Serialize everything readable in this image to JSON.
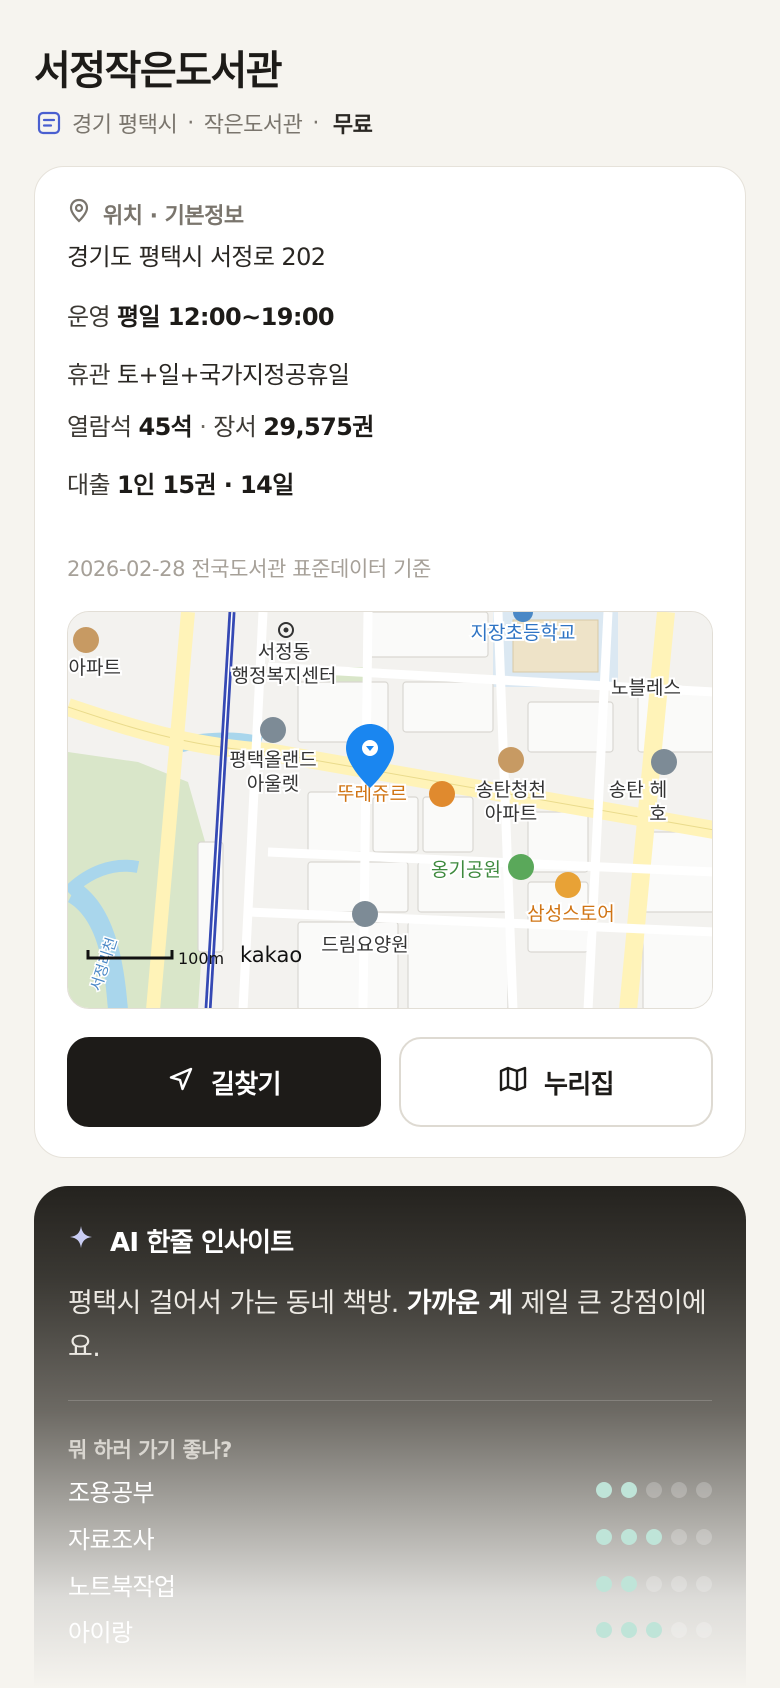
{
  "header": {
    "title": "서정작은도서관",
    "region": "경기 평택시",
    "sep1": "·",
    "type": "작은도서관",
    "sep2": "·",
    "fee": "무료"
  },
  "info": {
    "section_title": "위치 · 기본정보",
    "address": "경기도 평택시 서정로 202",
    "hours_label": "운영",
    "hours_value": "평일 12:00~19:00",
    "closed_label": "휴관",
    "closed_value": "토+일+국가지정공휴일",
    "seats_label": "열람석",
    "seats_value": "45석",
    "books_sep": "·",
    "books_label": "장서",
    "books_value": "29,575권",
    "loan_label": "대출",
    "loan_value": "1인 15권 · 14일",
    "as_of": "2026-02-28 전국도서관 표준데이터 기준"
  },
  "map": {
    "labels": {
      "school": "지장초등학교",
      "apt_left": "장아파트",
      "office_1": "서정동",
      "office_2": "행정복지센터",
      "noble": "노블레스",
      "outlet_1": "평택올랜드",
      "outlet_2": "아울렛",
      "bakery": "뚜레쥬르",
      "apt_right_1": "송탄청천",
      "apt_right_2": "아파트",
      "songtan_1": "송탄 헤",
      "songtan_2": "호",
      "park": "옹기공원",
      "store": "삼성스토어",
      "hospital": "드림요양원",
      "stream": "서정리천",
      "scale": "100m",
      "brand": "kakao"
    }
  },
  "actions": {
    "directions": "길찾기",
    "nurijip": "누리집"
  },
  "ai": {
    "title": "AI 한줄 인사이트",
    "insight_prefix": "평택시 걸어서 가는 동네 책방.",
    "insight_bold": "가까운 게",
    "insight_suffix": "제일 큰 강점이에요.",
    "question": "뭐 하러 가기 좋나?",
    "purposes": [
      {
        "name": "조용공부",
        "level": 2,
        "max": 5
      },
      {
        "name": "자료조사",
        "level": 3,
        "max": 5
      },
      {
        "name": "노트북작업",
        "level": 2,
        "max": 5
      },
      {
        "name": "아이랑",
        "level": 3,
        "max": 5
      }
    ]
  },
  "colors": {
    "background": "#f6f4ef",
    "accent_dark": "#1d1b18",
    "pin_blue": "#1a86f0",
    "dot_on": "#bfe4d8"
  }
}
